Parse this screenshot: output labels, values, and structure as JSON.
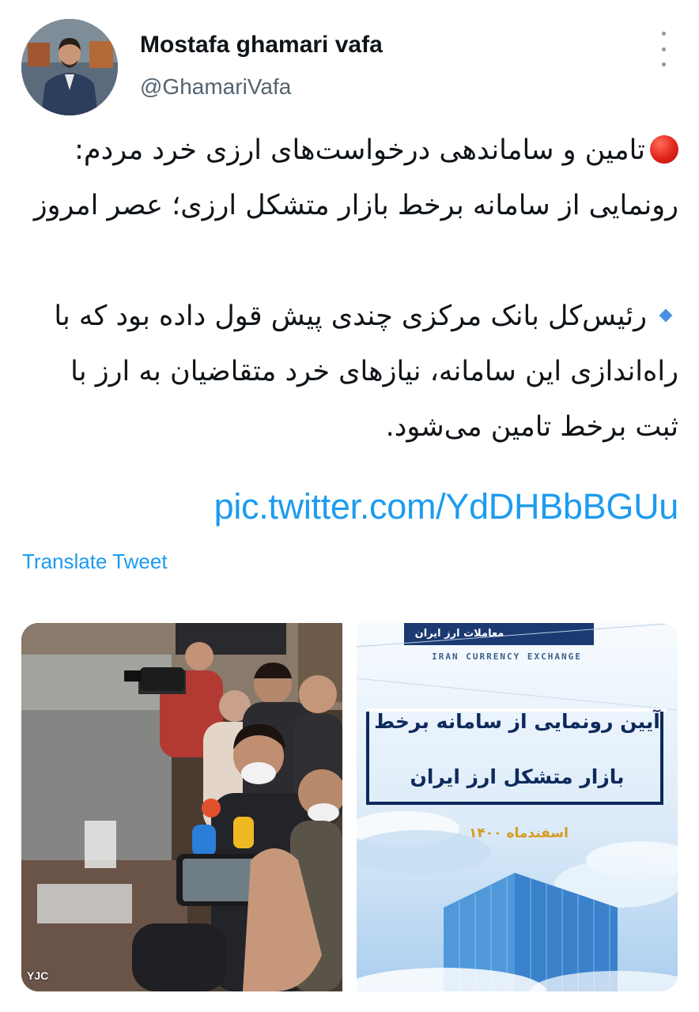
{
  "author": {
    "display_name": "Mostafa ghamari vafa",
    "handle": "@GhamariVafa"
  },
  "tweet": {
    "paragraph_1": "تامین و ساماندهی درخواست‌های ارزی خرد مردم: رونمایی از سامانه برخط بازار متشکل ارزی؛ عصر امروز",
    "paragraph_2": "رئیس‌کل بانک مرکزی چندی پیش قول داده بود که با راه‌اندازی این سامانه، نیازهای خرد متقاضیان به ارز با ثبت برخط تامین می‌شود.",
    "link": "pic.twitter.com/YdDHBbBGUu",
    "translate_label": "Translate Tweet"
  },
  "media": {
    "poster": {
      "org_name_fa": "معاملات ارز ایران",
      "org_name_en": "IRAN CURRENCY EXCHANGE",
      "title_line_1": "آیین رونمایی از سامانه برخط",
      "title_line_2": "بازار متشکل ارز ایران",
      "date": "اسفندماه ۱۴۰۰"
    },
    "watermark": "YJC"
  },
  "colors": {
    "link": "#1d9bf0",
    "text": "#0f1419",
    "muted": "#536471"
  },
  "icons": [
    "more-vertical-icon",
    "red-circle-emoji-icon",
    "blue-diamond-emoji-icon"
  ]
}
